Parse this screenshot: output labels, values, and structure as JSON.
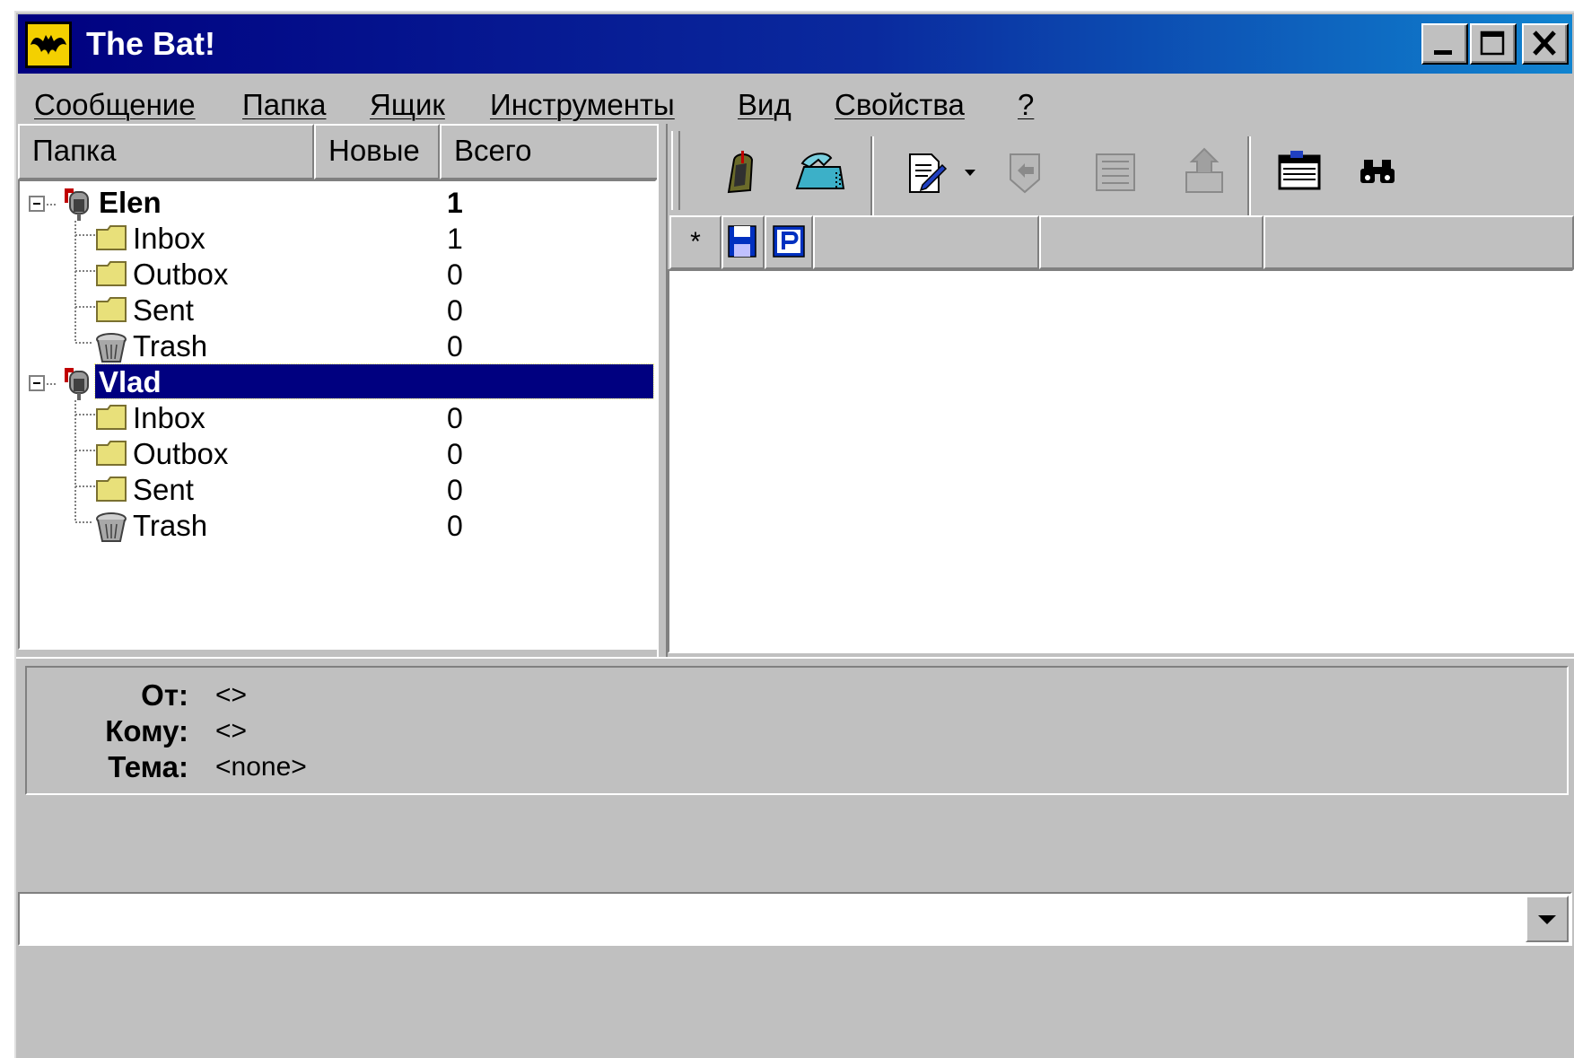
{
  "window": {
    "title": "The Bat!",
    "icon": "bat-logo-icon",
    "caption_buttons": [
      "minimize-icon",
      "maximize-icon",
      "close-icon"
    ]
  },
  "menu": [
    {
      "label": "Сообщение"
    },
    {
      "label": "Папка"
    },
    {
      "label": "Ящик"
    },
    {
      "label": "Инструменты"
    },
    {
      "label": "Вид"
    },
    {
      "label": "Свойства"
    },
    {
      "label": "?"
    }
  ],
  "folder_pane": {
    "columns": {
      "folder": "Папка",
      "new": "Новые",
      "total": "Всего"
    },
    "accounts": [
      {
        "name": "Elen",
        "count": "1",
        "selected": false,
        "folders": [
          {
            "name": "Inbox",
            "count": "1",
            "icon": "folder-icon"
          },
          {
            "name": "Outbox",
            "count": "0",
            "icon": "folder-icon"
          },
          {
            "name": "Sent",
            "count": "0",
            "icon": "folder-icon"
          },
          {
            "name": "Trash",
            "count": "0",
            "icon": "trash-bin-icon"
          }
        ]
      },
      {
        "name": "Vlad",
        "count": "",
        "selected": true,
        "folders": [
          {
            "name": "Inbox",
            "count": "0",
            "icon": "folder-icon"
          },
          {
            "name": "Outbox",
            "count": "0",
            "icon": "folder-icon"
          },
          {
            "name": "Sent",
            "count": "0",
            "icon": "folder-icon"
          },
          {
            "name": "Trash",
            "count": "0",
            "icon": "trash-bin-icon"
          }
        ]
      }
    ]
  },
  "toolbar": {
    "buttons": [
      "get-mail-icon",
      "send-mail-icon",
      "new-message-icon",
      "dropdown-arrow-icon",
      "reply-icon",
      "reply-all-icon",
      "forward-icon",
      "address-book-icon",
      "find-binoculars-icon"
    ]
  },
  "message_list": {
    "columns": [
      {
        "label": "*"
      },
      {
        "label": "",
        "icon": "save-disk-icon"
      },
      {
        "label": "",
        "icon": "priority-p-icon"
      },
      {
        "label": ""
      },
      {
        "label": ""
      },
      {
        "label": ""
      }
    ]
  },
  "header_preview": {
    "from_label": "От:",
    "from_value": "<>",
    "to_label": "Кому:",
    "to_value": "<>",
    "subject_label": "Тема:",
    "subject_value": "<none>"
  },
  "colors": {
    "title_gradient_start": "#000080",
    "title_gradient_end": "#1084d0",
    "selection": "#000080",
    "face": "#c0c0c0"
  }
}
